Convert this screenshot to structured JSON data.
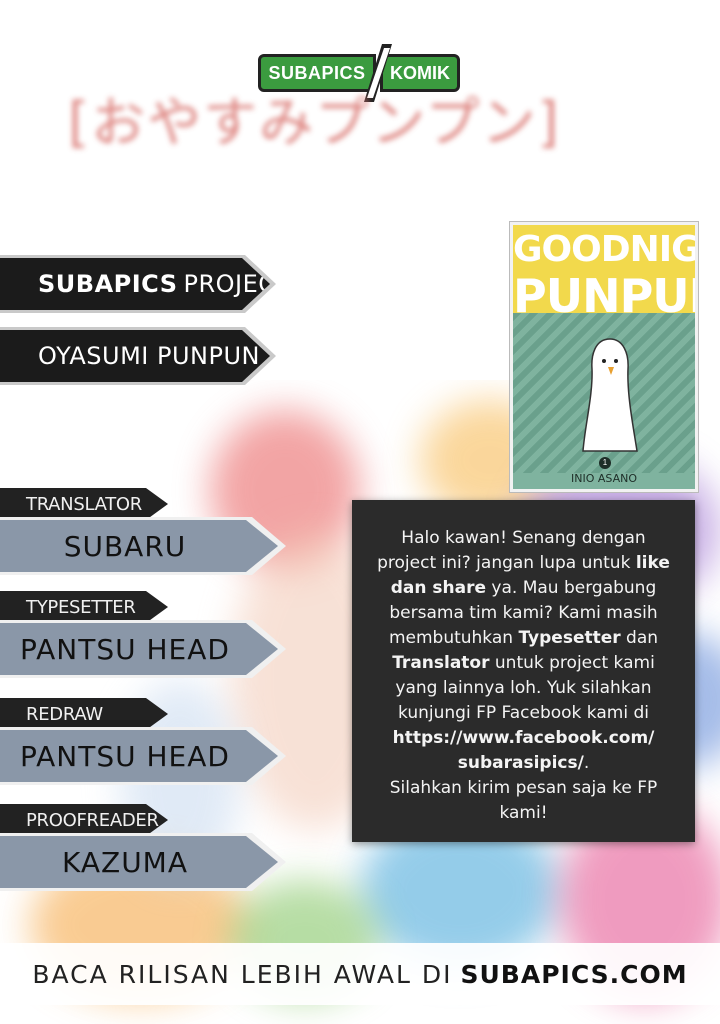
{
  "logo": {
    "left_text": "SUBAPICS",
    "right_text": "KOMIK",
    "accent": "#3b9b3f"
  },
  "japanese_title": "[おやすみプンプン]",
  "project_banner": {
    "bold": "SUBAPICS",
    "rest": "PROJECT"
  },
  "title_banner": "OYASUMI PUNPUN",
  "cover": {
    "title_line1": "GOODNIGHT",
    "title_line2": "PUNPUN",
    "volume": "1",
    "author": "INIO ASANO"
  },
  "credits": [
    {
      "role": "TRANSLATOR",
      "name": "SUBARU"
    },
    {
      "role": "TYPESETTER",
      "name": "PANTSU HEAD"
    },
    {
      "role": "REDRAW",
      "name": "PANTSU HEAD"
    },
    {
      "role": "PROOFREADER",
      "name": "KAZUMA"
    }
  ],
  "message": {
    "p1": "Halo kawan! Senang dengan project ini? jangan lupa untuk ",
    "b1": "like dan share",
    "p2": " ya. Mau bergabung bersama tim kami? Kami masih membutuhkan ",
    "b2": "Typesetter",
    "p3": " dan ",
    "b3": "Translator",
    "p4": " untuk project kami yang lainnya loh. Yuk silahkan kunjungi FP Facebook kami di ",
    "b4": "https://www.facebook.com/ subarasipics/",
    "p5": ".",
    "p6": "Silahkan kirim pesan saja ke FP kami!"
  },
  "footer": {
    "text": "BACA RILISAN LEBIH AWAL DI",
    "site": "SUBAPICS.COM"
  }
}
